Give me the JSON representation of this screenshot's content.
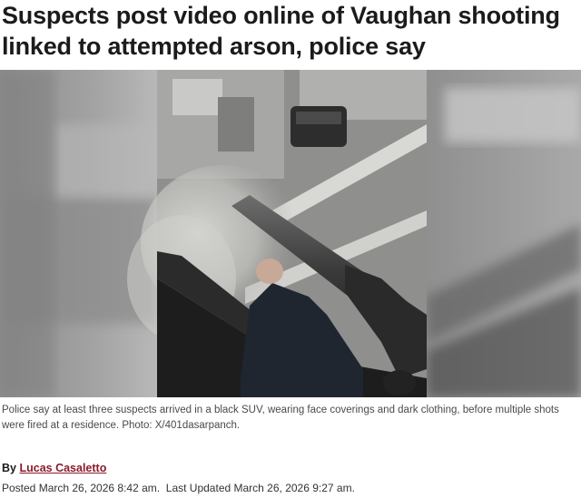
{
  "article": {
    "headline": "Suspects post video online of Vaughan shooting linked to attempted arson, police say",
    "caption": "Police say at least three suspects arrived in a black SUV, wearing face coverings and dark clothing, before multiple shots were fired at a residence. Photo: X/401dasarpanch.",
    "byline_prefix": "By",
    "author": "Lucas Casaletto",
    "posted": "Posted March 26, 2026 8:42 am.",
    "updated": "Last Updated March 26, 2026 9:27 am."
  }
}
